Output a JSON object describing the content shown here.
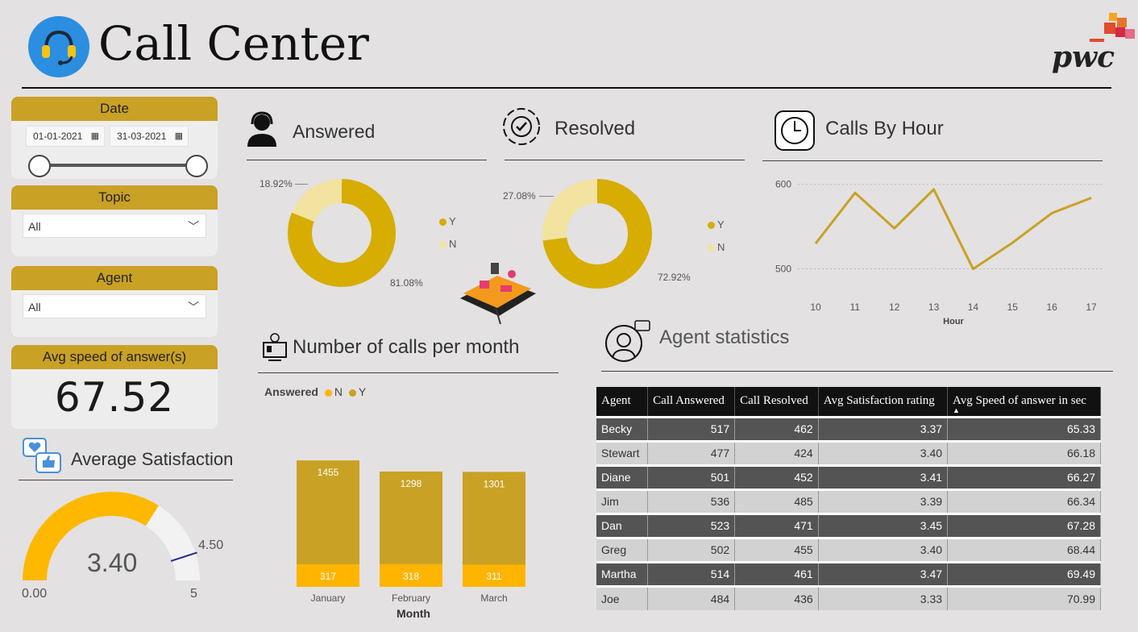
{
  "header": {
    "title": "Call Center",
    "brand": "pwc"
  },
  "date_slicer": {
    "label": "Date",
    "start": "01-01-2021",
    "end": "31-03-2021"
  },
  "topic_slicer": {
    "label": "Topic",
    "value": "All"
  },
  "agent_slicer": {
    "label": "Agent",
    "value": "All"
  },
  "speed_card": {
    "label": "Avg speed of answer(s)",
    "value": "67.52"
  },
  "satisfaction": {
    "title": "Average Satisfaction",
    "value": "3.40",
    "min": "0.00",
    "max": "5",
    "target": "4.50",
    "value_num": 3.4,
    "max_num": 5,
    "target_num": 4.5
  },
  "answered": {
    "title": "Answered",
    "legend": [
      "Y",
      "N"
    ],
    "y_label": "81.08%",
    "n_label": "18.92%",
    "y_pct": 81.08
  },
  "resolved": {
    "title": "Resolved",
    "legend": [
      "Y",
      "N"
    ],
    "y_label": "72.92%",
    "n_label": "27.08%",
    "y_pct": 72.92
  },
  "calls_by_hour": {
    "title": "Calls By Hour"
  },
  "calls_per_month": {
    "title": "Number of calls per month",
    "legend_title": "Answered"
  },
  "agent_stats": {
    "title": "Agent statistics",
    "columns": [
      "Agent",
      "Call Answered",
      "Call Resolved",
      "Avg Satisfaction rating",
      "Avg Speed of answer in sec"
    ],
    "rows": [
      [
        "Becky",
        "517",
        "462",
        "3.37",
        "65.33"
      ],
      [
        "Stewart",
        "477",
        "424",
        "3.40",
        "66.18"
      ],
      [
        "Diane",
        "501",
        "452",
        "3.41",
        "66.27"
      ],
      [
        "Jim",
        "536",
        "485",
        "3.39",
        "66.34"
      ],
      [
        "Dan",
        "523",
        "471",
        "3.45",
        "67.28"
      ],
      [
        "Greg",
        "502",
        "455",
        "3.40",
        "68.44"
      ],
      [
        "Martha",
        "514",
        "461",
        "3.47",
        "69.49"
      ],
      [
        "Joe",
        "484",
        "436",
        "3.33",
        "70.99"
      ]
    ]
  },
  "colors": {
    "gold": "#c9a124",
    "orange": "#ffb400",
    "pale": "#f2e3a0",
    "donut": "#d6ad00"
  },
  "chart_data": [
    {
      "type": "line",
      "title": "Calls By Hour",
      "xlabel": "Hour",
      "x": [
        10,
        11,
        12,
        13,
        14,
        15,
        16,
        17
      ],
      "series": [
        {
          "values": [
            530,
            590,
            548,
            594,
            500,
            531,
            566,
            584
          ]
        }
      ],
      "ylim": [
        470,
        615
      ],
      "yticks": [
        500,
        600
      ],
      "grid": true
    },
    {
      "type": "bar",
      "stacked": true,
      "title": "Number of calls per month",
      "xlabel": "Month",
      "categories": [
        "January",
        "February",
        "March"
      ],
      "legend_title": "Answered",
      "series": [
        {
          "name": "N",
          "values": [
            317,
            318,
            311
          ],
          "color": "#ffb400"
        },
        {
          "name": "Y",
          "values": [
            1455,
            1298,
            1301
          ],
          "color": "#c9a124"
        }
      ]
    }
  ]
}
